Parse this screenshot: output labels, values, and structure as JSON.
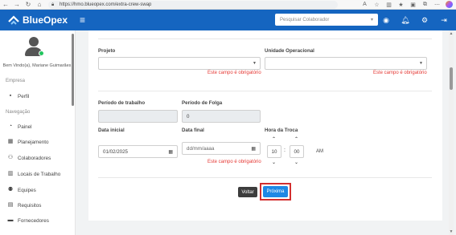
{
  "browser": {
    "url": "https://hmo.blueopex.com/extra-crew-swap"
  },
  "header": {
    "brand": "BlueOpex",
    "search_placeholder": "Pesquisar Colaborador"
  },
  "sidebar": {
    "welcome": "Bem Vindo(a), Mariane Guimarães",
    "section_empresa": "Empresa",
    "section_navegacao": "Navegação",
    "items": [
      {
        "label": "Perfil",
        "icon": "user-icon"
      },
      {
        "label": "Painel",
        "icon": "dashboard-icon"
      },
      {
        "label": "Planejamento",
        "icon": "calendar-icon"
      },
      {
        "label": "Colaboradores",
        "icon": "users-icon"
      },
      {
        "label": "Locais de Trabalho",
        "icon": "building-icon"
      },
      {
        "label": "Equipes",
        "icon": "team-icon"
      },
      {
        "label": "Requisitos",
        "icon": "clipboard-icon"
      },
      {
        "label": "Fornecedores",
        "icon": "truck-icon"
      }
    ]
  },
  "form": {
    "projeto_label": "Projeto",
    "unidade_label": "Unidade Operacional",
    "required_error": "Este campo é obrigatório",
    "periodo_trabalho_label": "Período de trabalho",
    "periodo_folga_label": "Período de Folga",
    "periodo_folga_value": "0",
    "data_inicial_label": "Data inicial",
    "data_inicial_value": "01/02/2025",
    "data_final_label": "Data final",
    "data_final_placeholder": "dd/mm/aaaa",
    "hora_troca_label": "Hora da Troca",
    "hora_value": "10",
    "minuto_value": "00",
    "ampm": "AM",
    "voltar_label": "Voltar",
    "proxima_label": "Próxima"
  },
  "colors": {
    "header_bg": "#1565c0",
    "error": "#e53935",
    "primary_button": "#1e88e5",
    "highlight_frame": "#d32f2f"
  }
}
